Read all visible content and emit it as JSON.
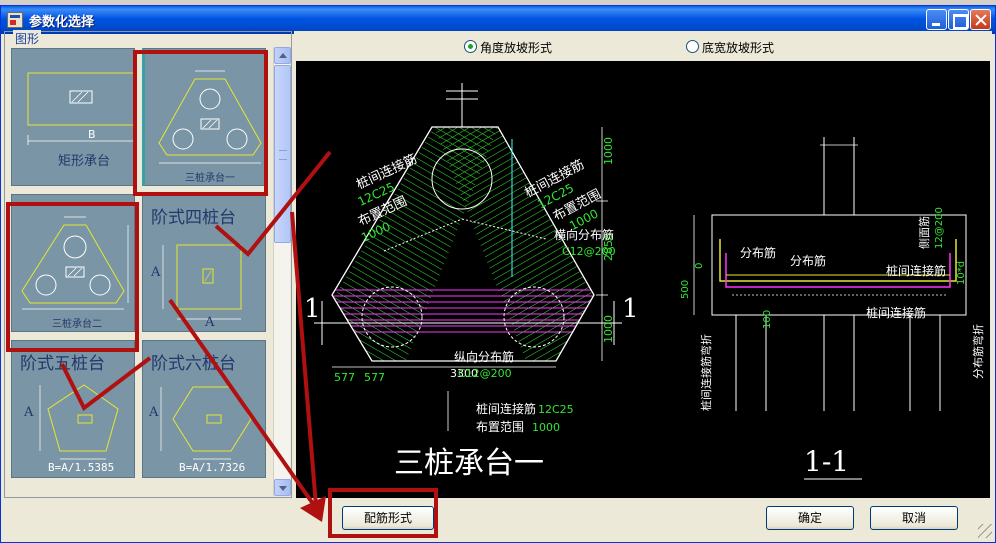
{
  "window": {
    "title": "参数化选择"
  },
  "left_panel": {
    "group_label": "图形",
    "thumbnails": [
      {
        "label": "矩形承台",
        "dim": "B"
      },
      {
        "label": "三桩承台一"
      },
      {
        "label": "三桩承台二"
      },
      {
        "label": "阶式四桩台",
        "dim_a": "A",
        "dim_a2": "A"
      },
      {
        "label": "阶式五桩台",
        "dim_a": "A",
        "formula": "B=A/1.5385"
      },
      {
        "label": "阶式六桩台",
        "dim_a": "A",
        "formula": "B=A/1.7326"
      }
    ]
  },
  "slope_options": [
    {
      "label": "角度放坡形式",
      "selected": true
    },
    {
      "label": "底宽放坡形式",
      "selected": false
    }
  ],
  "drawing": {
    "plan_title": "三桩承台一",
    "section_title": "1-1",
    "section_mark": "1",
    "plan_labels": {
      "pile_link_left": "桩间连接筋",
      "pile_link_left_spec": "12C25",
      "range_left": "布置范围",
      "range_left_val": "1000",
      "pile_link_right": "桩间连接筋",
      "pile_link_right_spec": "12C25",
      "range_right": "布置范围",
      "range_right_val": "1000",
      "horiz_dist": "横向分布筋",
      "horiz_dist_spec": "C12@200",
      "vert_dist": "纵向分布筋",
      "vert_dist_spec": "C12@200",
      "bottom_link": "桩间连接筋",
      "bottom_link_spec": "12C25",
      "bottom_range": "布置范围",
      "bottom_range_val": "1000",
      "dim_right_top": "1000",
      "dim_right_mid": "2858",
      "dim_right_bot": "1000",
      "dim_bottom_a": "577",
      "dim_bottom_b": "577",
      "dim_bottom_total": "3300"
    },
    "section_labels": {
      "dist_left": "分布筋",
      "dist_mid": "分布筋",
      "side_bar": "侧面筋",
      "side_bar_spec": "12@200",
      "link_top": "桩间连接筋",
      "link_bottom": "桩间连接筋",
      "link_bend": "桩间连接筋弯折",
      "dist_bend": "分布筋弯折",
      "d500": "500",
      "d0": "0",
      "d100": "100",
      "d10d": "10*d"
    }
  },
  "buttons": {
    "rebar_form": "配筋形式",
    "ok": "确定",
    "cancel": "取消"
  },
  "colors": {
    "annotation_red": "#b01010",
    "rebar_green": "#33e633",
    "rebar_magenta": "#ff33ff",
    "outline_yellow": "#e6e633",
    "dim_cyan": "#33ffff"
  }
}
